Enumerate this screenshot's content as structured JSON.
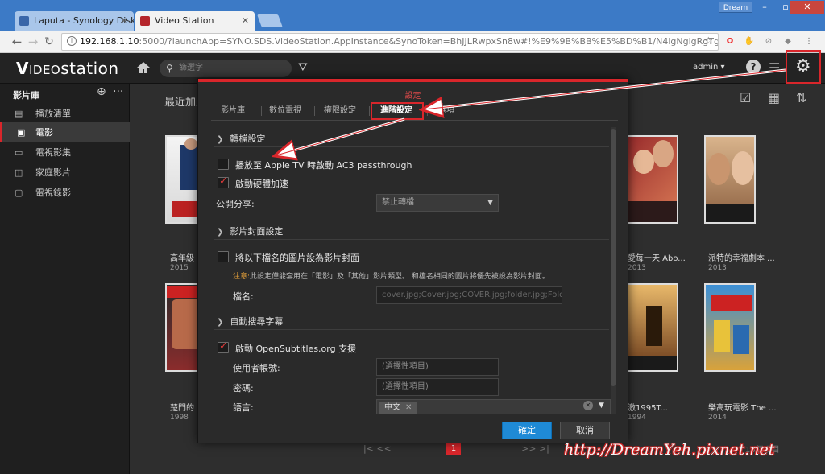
{
  "browser": {
    "tabs": [
      {
        "label": "Laputa - Synology Disk",
        "favicon_color": "#3a66a8"
      },
      {
        "label": "Video Station",
        "favicon_color": "#b5262c"
      }
    ],
    "window_user": "Dream",
    "url_host": "192.168.1.10",
    "url_rest": ":5000/?launchApp=SYNO.SDS.VideoStation.AppInstance&SynoToken=BhJJLRwpxSn8w#!%E9%9B%BB%E5%BD%B1/N4lgNglgRgTghjA"
  },
  "header": {
    "logo_bold": "V",
    "logo_video": "IDEO",
    "logo_station": "station",
    "search_placeholder": "篩選字",
    "user": "admin ▾"
  },
  "sidebar": {
    "title": "影片庫",
    "items": [
      {
        "label": "播放清單",
        "icon": "playlist-icon"
      },
      {
        "label": "電影",
        "icon": "movie-icon"
      },
      {
        "label": "電視影集",
        "icon": "tv-icon"
      },
      {
        "label": "家庭影片",
        "icon": "camera-icon"
      },
      {
        "label": "電視錄影",
        "icon": "record-icon"
      }
    ]
  },
  "main": {
    "section_title": "最近加入",
    "posters": [
      {
        "title": "高年級",
        "year": "2015"
      },
      {
        "title": "愛每一天 Abo...",
        "year": "2013"
      },
      {
        "title": "派特的幸福劇本 ...",
        "year": "2013"
      },
      {
        "title": "楚門的",
        "year": "1998"
      },
      {
        "title": "激1995T...",
        "year": "1994"
      },
      {
        "title": "樂高玩電影 The ...",
        "year": "2014"
      }
    ],
    "page": "1",
    "total": "16個項目"
  },
  "modal": {
    "title": "設定",
    "tabs": [
      "影片庫",
      "數位電視",
      "權限設定",
      "進階設定",
      "選項"
    ],
    "active_tab": "進階設定",
    "sections": {
      "transcode": {
        "header": "轉檔設定",
        "ac3_label": "播放至 Apple TV 時啟動 AC3 passthrough",
        "ac3_checked": false,
        "hw_label": "啟動硬體加速",
        "hw_checked": true,
        "share_label": "公開分享:",
        "share_value": "禁止轉檔"
      },
      "cover": {
        "header": "影片封面設定",
        "cover_label": "將以下檔名的圖片設為影片封面",
        "cover_checked": false,
        "note_prefix": "注意:",
        "note_text": "此設定僅能套用在「電影」及「其他」影片類型。 和檔名相同的圖片將優先被設為影片封面。",
        "filename_label": "檔名:",
        "filename_value": "cover.jpg;Cover.jpg;COVER.jpg;folder.jpg;Folde"
      },
      "subtitle": {
        "header": "自動搜尋字幕",
        "enable_label": "啟動 OpenSubtitles.org 支援",
        "enable_checked": true,
        "account_label": "使用者帳號:",
        "account_placeholder": "(選擇性項目)",
        "password_label": "密碼:",
        "password_placeholder": "(選擇性項目)",
        "language_label": "語言:",
        "language_tag": "中文"
      }
    },
    "ok_label": "確定",
    "cancel_label": "取消"
  },
  "watermark": "http://DreamYeh.pixnet.net",
  "colors": {
    "accent_red": "#d9262b",
    "primary_blue": "#1f8ad6"
  }
}
